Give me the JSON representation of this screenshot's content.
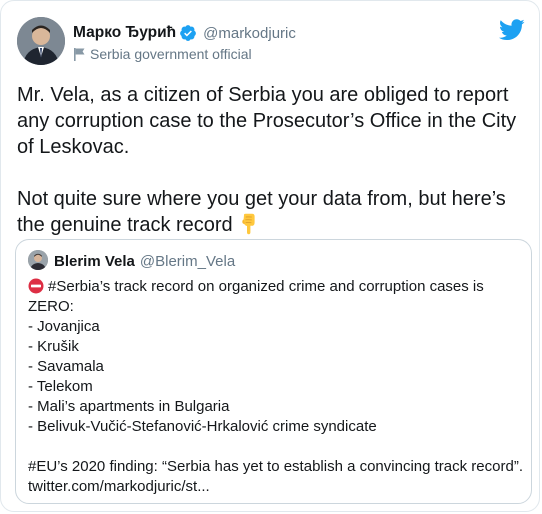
{
  "tweet": {
    "author": {
      "display_name": "Марко Ђурић",
      "handle": "@markodjuric",
      "label": "Serbia government official",
      "verified": true
    },
    "paragraphs": [
      "Mr. Vela, as a citizen of Serbia you are obliged to report any corruption case to the Prosecutor’s Office in the City of Leskovac.",
      "Not quite sure where you get your data from, but here’s the genuine track record"
    ],
    "emoji": "backhand-index-pointing-down-icon"
  },
  "quoted_tweet": {
    "author": {
      "display_name": "Blerim Vela",
      "handle": "@Blerim_Vela"
    },
    "intro": "#Serbia’s track record on organized crime and corruption cases is ZERO:",
    "items": [
      "- Jovanjica",
      "- Krušik",
      "- Savamala",
      "- Telekom",
      "- Mali’s apartments in Bulgaria",
      "- Belivuk-Vučić-Stefanović-Hrkalović crime syndicate"
    ],
    "finding": "#EU’s 2020 finding: “Serbia has yet to establish a convincing track record”.",
    "link": "twitter.com/markodjuric/st..."
  },
  "colors": {
    "twitter_blue": "#1da1f2",
    "secondary_text": "#657786",
    "border": "#e1e8ed"
  }
}
